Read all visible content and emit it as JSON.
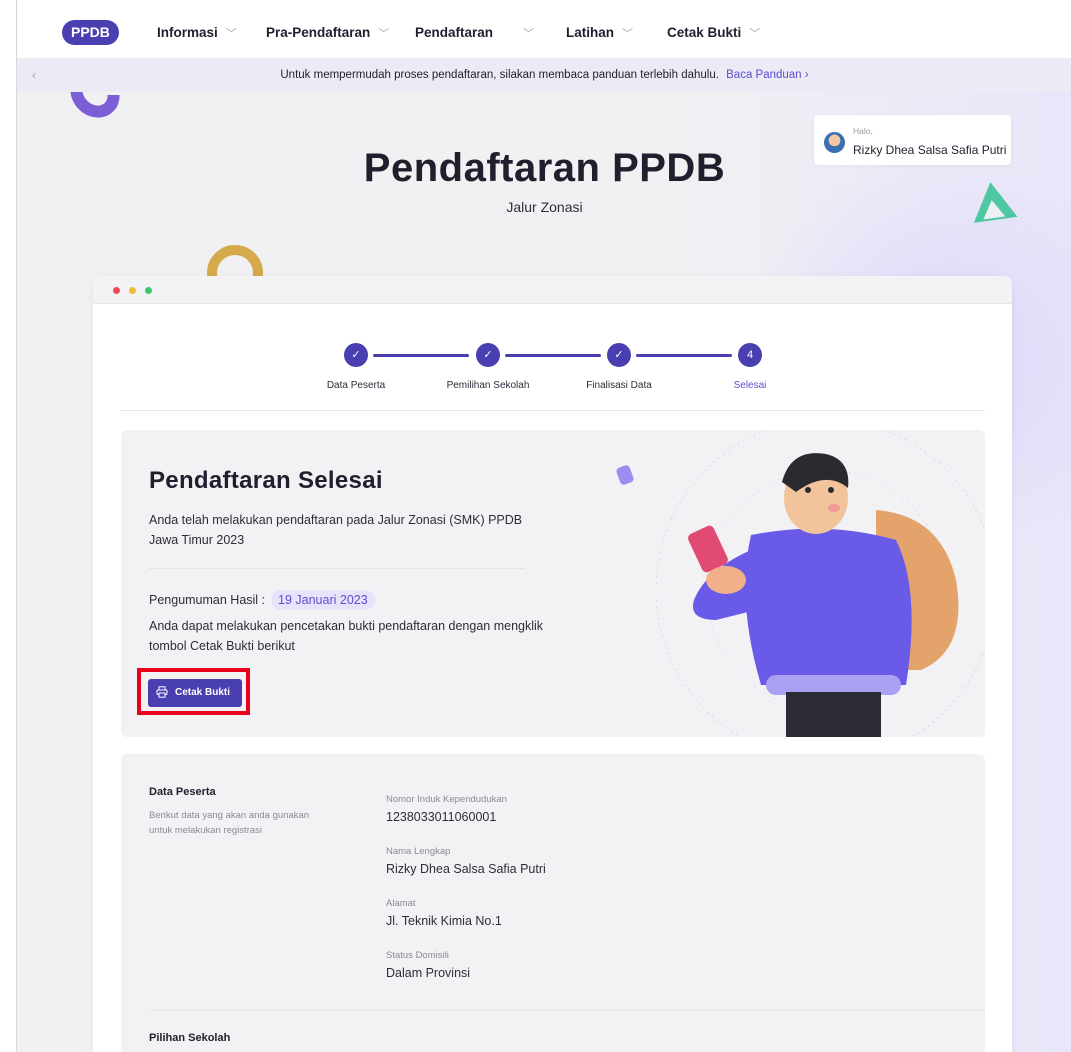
{
  "nav": {
    "logo": "PPDB",
    "items": [
      {
        "label": "Informasi"
      },
      {
        "label": "Pra-Pendaftaran"
      },
      {
        "label": "Pendaftaran"
      },
      {
        "label": "Latihan"
      },
      {
        "label": "Cetak Bukti"
      }
    ]
  },
  "banner": {
    "text": "Untuk mempermudah proses pendaftaran, silakan membaca panduan terlebih dahulu.",
    "link": "Baca Panduan ›"
  },
  "hero": {
    "title": "Pendaftaran PPDB",
    "subtitle": "Jalur Zonasi"
  },
  "user": {
    "greeting": "Halo,",
    "name": "Rizky Dhea Salsa Safia Putri"
  },
  "stepper": {
    "steps": [
      {
        "label": "Data Peserta",
        "marker": "✓"
      },
      {
        "label": "Pemilihan Sekolah",
        "marker": "✓"
      },
      {
        "label": "Finalisasi Data",
        "marker": "✓"
      },
      {
        "label": "Selesai",
        "marker": "4"
      }
    ],
    "active_step": 4
  },
  "completion": {
    "title": "Pendaftaran Selesai",
    "description": "Anda telah melakukan pendaftaran pada Jalur Zonasi (SMK) PPDB Jawa Timur 2023",
    "announcement_label": "Pengumuman Hasil :",
    "announcement_date": "19 Januari 2023",
    "print_info": "Anda dapat melakukan pencetakan bukti pendaftaran dengan mengklik tombol Cetak Bukti berikut",
    "print_button": "Cetak Bukti"
  },
  "participant": {
    "title": "Data Peserta",
    "description": "Berikut data yang akan anda gunakan untuk melakukan registrasi",
    "fields": [
      {
        "label": "Nomor Induk Kependudukan",
        "value": "1238033011060001"
      },
      {
        "label": "Nama Lengkap",
        "value": "Rizky Dhea Salsa Safia Putri"
      },
      {
        "label": "Alamat",
        "value": "Jl. Teknik Kimia No.1"
      },
      {
        "label": "Status Domisili",
        "value": "Dalam Provinsi"
      }
    ]
  },
  "school_choice": {
    "title": "Pilihan Sekolah"
  },
  "colors": {
    "primary": "#4a3fb0",
    "accent": "#5b4fd0",
    "highlight": "#e8001d"
  }
}
